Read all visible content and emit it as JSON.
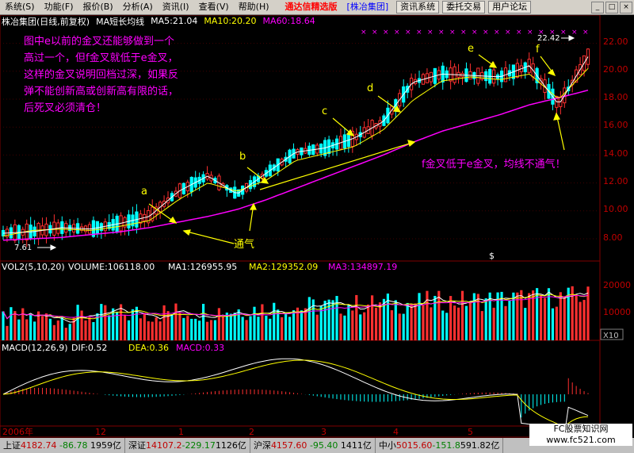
{
  "menu": {
    "items": [
      "系统(S)",
      "功能(F)",
      "报价(B)",
      "分析(A)",
      "资讯(I)",
      "查看(V)",
      "帮助(H)"
    ],
    "brand": "通达信精选版",
    "stock_tab": "[株冶集团]",
    "buttons": [
      "资讯系统",
      "委托交易",
      "用户论坛"
    ]
  },
  "window_buttons": [
    "minimize-icon",
    "restore-icon",
    "close-icon"
  ],
  "main_header": {
    "title": "株冶集团(日线,前复权)",
    "indicator": "MA短长均线",
    "ma5": "MA5:21.04",
    "ma10": "MA10:20.20",
    "ma60": "MA60:18.64",
    "colors": {
      "ma5": "#ffffff",
      "ma10": "#ffff00",
      "ma60": "#ff00ff"
    }
  },
  "price_axis": [
    "22.00",
    "20.00",
    "18.00",
    "16.00",
    "14.00",
    "12.00",
    "10.00",
    "8.00"
  ],
  "volume_header": {
    "title": "VOL2(5,10,20)",
    "volume": "VOLUME:106118.00",
    "ma1": "MA1:126955.95",
    "ma2": "MA2:129352.09",
    "ma3": "MA3:134897.19"
  },
  "volume_axis": [
    "20000",
    "10000",
    "X10"
  ],
  "macd_header": {
    "title": "MACD(12,26,9)",
    "dif": "DIF:0.52",
    "dea": "DEA:0.36",
    "macd": "MACD:0.33"
  },
  "annotations": {
    "note_lines": [
      "图中e以前的金叉还能够做到一个",
      "高过一个，但f金叉就低于e金叉，",
      "这样的金叉说明回档过深，如果反",
      "弹不能创新高或创新高有限的话，",
      "后死叉必须清仓！"
    ],
    "labels": [
      "a",
      "b",
      "c",
      "d",
      "e",
      "f"
    ],
    "tongqi": "通气",
    "low_label": "7.61",
    "high_label": "22.42",
    "f_note": "f金叉低于e金叉，均线不通气！",
    "dollar": "$"
  },
  "date_axis": [
    "2006年",
    "12",
    "1",
    "2",
    "3",
    "4",
    "5",
    "6"
  ],
  "status_bar": {
    "sh": {
      "name": "上证",
      "value": "4182.74",
      "change": "-86.78",
      "amount": "1959亿"
    },
    "sz": {
      "name": "深证",
      "value": "14107.2",
      "change": "-229.17",
      "amount": "1126亿"
    },
    "hs": {
      "name": "沪深",
      "value": "4157.60",
      "change": "-95.40",
      "amount": "1411亿"
    },
    "zx": {
      "name": "中小",
      "value": "5015.60",
      "change": "-151.8",
      "amount": "591.82亿"
    },
    "watermark1": "FC股票知识网",
    "watermark2": "www.fc521.com"
  },
  "chart_data": {
    "type": "line",
    "title": "株冶集团(日线,前复权)",
    "ylim": [
      7,
      23
    ],
    "series": [
      {
        "name": "MA60",
        "values": [
          7.9,
          8.0,
          8.1,
          8.3,
          8.5,
          8.8,
          9.2,
          9.6,
          10.1,
          10.8,
          11.6,
          12.4,
          13.2,
          14.0,
          14.9,
          15.7,
          16.3,
          16.9,
          17.6,
          18.1,
          18.64
        ]
      },
      {
        "name": "MA10",
        "values": [
          8.2,
          8.6,
          8.7,
          8.6,
          8.9,
          9.3,
          10.8,
          12.0,
          11.4,
          12.2,
          13.6,
          14.1,
          14.6,
          15.8,
          17.9,
          19.3,
          19.6,
          19.4,
          19.8,
          18.0,
          20.2
        ]
      },
      {
        "name": "MA5",
        "values": [
          8.4,
          8.5,
          8.8,
          8.7,
          9.1,
          9.6,
          11.4,
          12.5,
          11.2,
          12.7,
          14.2,
          14.5,
          15.2,
          16.4,
          19.2,
          19.8,
          19.7,
          19.6,
          20.4,
          17.6,
          21.04
        ]
      }
    ],
    "volume_ylim": [
      0,
      25000
    ],
    "macd": {
      "dif": 0.52,
      "dea": 0.36,
      "macd": 0.33
    }
  }
}
